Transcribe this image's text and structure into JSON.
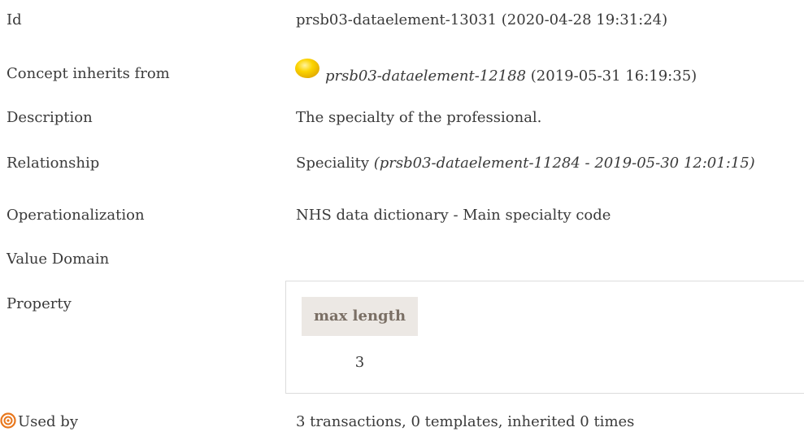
{
  "fields": {
    "id": {
      "label": "Id",
      "value": "prsb03-dataelement-13031 (2020-04-28 19:31:24)"
    },
    "inherits": {
      "label": "Concept inherits from",
      "ref": "prsb03-dataelement-12188",
      "date": "(2019-05-31 16:19:35)",
      "status_color": "#f5c400"
    },
    "description": {
      "label": "Description",
      "value": "The specialty of the professional."
    },
    "relationship": {
      "label": "Relationship",
      "name": "Speciality",
      "ref": "(prsb03-dataelement-11284 - 2019-05-30 12:01:15)"
    },
    "operationalization": {
      "label": "Operationalization",
      "value": "NHS data dictionary - Main specialty code"
    },
    "value_domain": {
      "label": "Value Domain"
    },
    "property": {
      "label": "Property",
      "header": "max length",
      "value": "3"
    },
    "used_by": {
      "label": "Used by",
      "value": "3 transactions, 0 templates, inherited 0 times",
      "icon": "target-icon",
      "icon_color": "#e8771d"
    }
  }
}
